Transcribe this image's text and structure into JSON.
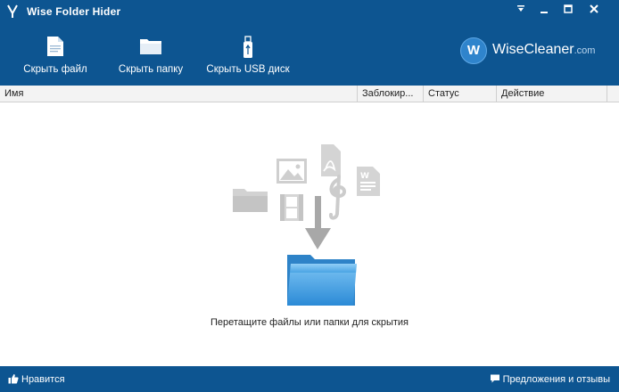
{
  "window": {
    "title": "Wise Folder Hider",
    "controls": [
      "menu-icon",
      "minimize-icon",
      "maximize-icon",
      "close-icon"
    ]
  },
  "toolbar": {
    "hide_file": "Скрыть файл",
    "hide_folder": "Скрыть папку",
    "hide_usb": "Скрыть USB диск"
  },
  "brand": {
    "logo_letter": "W",
    "name": "WiseCleaner",
    "suffix": ".com"
  },
  "table": {
    "columns": [
      "Имя",
      "Заблокир...",
      "Статус",
      "Действие"
    ]
  },
  "drop_zone": {
    "caption": "Перетащите файлы или папки для скрытия",
    "icons": [
      "folder-icon",
      "image-icon",
      "pdf-icon",
      "music-icon",
      "document-icon",
      "film-icon",
      "arrow-down-icon",
      "blue-folder-icon"
    ]
  },
  "status": {
    "like": "Нравится",
    "feedback": "Предложения и отзывы"
  },
  "colors": {
    "chrome": "#0d5591",
    "accent": "#2f84cc",
    "watermark_icons": "#cfcfcf"
  }
}
